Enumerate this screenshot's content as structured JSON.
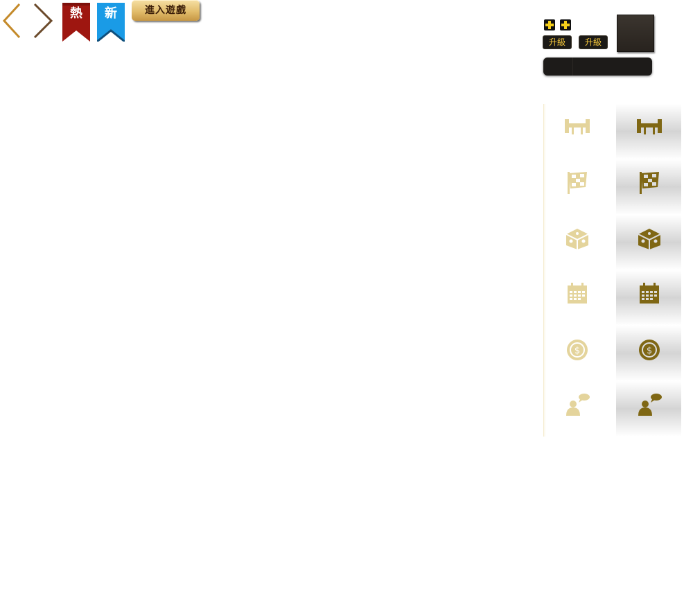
{
  "nav": {
    "prev_icon": "chevron-left-icon",
    "next_icon": "chevron-right-icon"
  },
  "ribbons": {
    "hot": "熱",
    "new": "新",
    "hot_color": "#9e1610",
    "new_color": "#1a9be6"
  },
  "enter_game_label": "進入遊戲",
  "account": {
    "upgrade_1": "升級",
    "upgrade_2": "升級"
  },
  "menu": {
    "icons": [
      "table-chairs-icon",
      "checkered-flag-icon",
      "dice-icon",
      "calendar-icon",
      "dollar-coin-icon",
      "chat-person-icon"
    ],
    "light_color": "#e4d49c",
    "dark_color": "#7f6714"
  }
}
